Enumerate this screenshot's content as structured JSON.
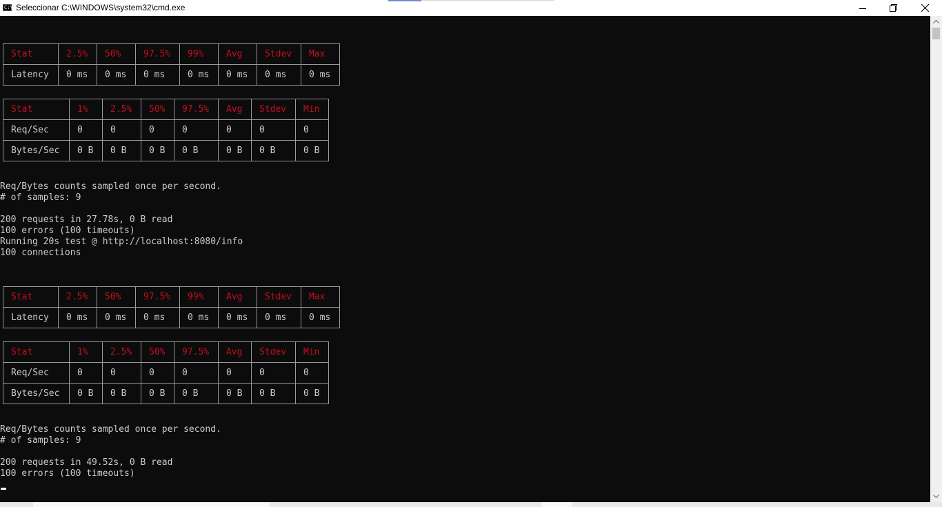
{
  "window": {
    "title": "Seleccionar C:\\WINDOWS\\system32\\cmd.exe",
    "icon_label": "C:\\",
    "icons": {
      "app": "cmd-icon",
      "minimize": "minimize-icon",
      "maximize": "restore-icon",
      "close": "close-icon"
    }
  },
  "colors": {
    "background": "#0c0c0c",
    "text": "#cccccc",
    "header": "#c50f1f",
    "border": "#9a9a9a"
  },
  "run1": {
    "latency": {
      "header": [
        "Stat",
        "2.5%",
        "50%",
        "97.5%",
        "99%",
        "Avg",
        "Stdev",
        "Max"
      ],
      "rows": [
        [
          "Latency",
          "0 ms",
          "0 ms",
          "0 ms",
          "0 ms",
          "0 ms",
          "0 ms",
          "0 ms"
        ]
      ]
    },
    "throughput": {
      "header": [
        "Stat",
        "1%",
        "2.5%",
        "50%",
        "97.5%",
        "Avg",
        "Stdev",
        "Min"
      ],
      "rows": [
        [
          "Req/Sec",
          "0",
          "0",
          "0",
          "0",
          "0",
          "0",
          "0"
        ],
        [
          "Bytes/Sec",
          "0 B",
          "0 B",
          "0 B",
          "0 B",
          "0 B",
          "0 B",
          "0 B"
        ]
      ]
    },
    "lines": [
      "Req/Bytes counts sampled once per second.",
      "# of samples: 9",
      "200 requests in 27.78s, 0 B read",
      "100 errors (100 timeouts)",
      "Running 20s test @ http://localhost:8080/info",
      "100 connections"
    ]
  },
  "run2": {
    "latency": {
      "header": [
        "Stat",
        "2.5%",
        "50%",
        "97.5%",
        "99%",
        "Avg",
        "Stdev",
        "Max"
      ],
      "rows": [
        [
          "Latency",
          "0 ms",
          "0 ms",
          "0 ms",
          "0 ms",
          "0 ms",
          "0 ms",
          "0 ms"
        ]
      ]
    },
    "throughput": {
      "header": [
        "Stat",
        "1%",
        "2.5%",
        "50%",
        "97.5%",
        "Avg",
        "Stdev",
        "Min"
      ],
      "rows": [
        [
          "Req/Sec",
          "0",
          "0",
          "0",
          "0",
          "0",
          "0",
          "0"
        ],
        [
          "Bytes/Sec",
          "0 B",
          "0 B",
          "0 B",
          "0 B",
          "0 B",
          "0 B",
          "0 B"
        ]
      ]
    },
    "lines": [
      "Req/Bytes counts sampled once per second.",
      "# of samples: 9",
      "200 requests in 49.52s, 0 B read",
      "100 errors (100 timeouts)"
    ]
  }
}
